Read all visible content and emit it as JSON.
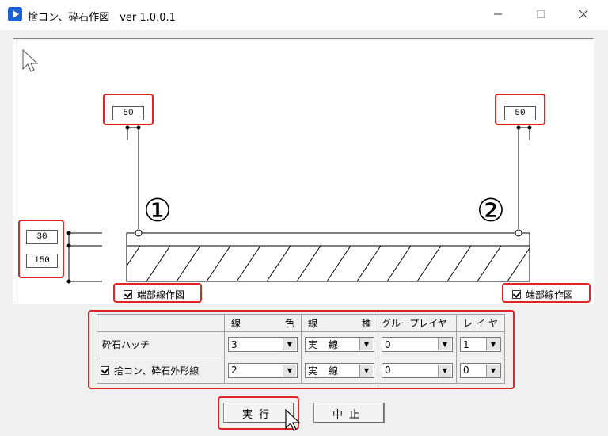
{
  "window": {
    "title": "捨コン、砕石作図　ver 1.0.0.1",
    "controls": [
      "minimize-icon",
      "maximize-icon",
      "close-icon"
    ]
  },
  "canvas": {
    "top_left_value": "50",
    "top_right_value": "50",
    "left_upper_value": "30",
    "left_lower_value": "150",
    "marker_1": "①",
    "marker_2": "②",
    "end_line_left": {
      "label": "端部線作図",
      "checked": true
    },
    "end_line_right": {
      "label": "端部線作図",
      "checked": true
    }
  },
  "settings": {
    "headers": {
      "color": [
        "線",
        "色"
      ],
      "linetype": [
        "線",
        "種"
      ],
      "group_layer": "グループレイヤ",
      "layer": [
        "レ",
        "イ",
        "ヤ"
      ]
    },
    "rows": [
      {
        "label": "砕石ハッチ",
        "has_checkbox": false,
        "color": "3",
        "linetype": [
          "実",
          "線"
        ],
        "group_layer": "0",
        "layer": "1"
      },
      {
        "label": "捨コン、砕石外形線",
        "has_checkbox": true,
        "checked": true,
        "color": "2",
        "linetype": [
          "実",
          "線"
        ],
        "group_layer": "0",
        "layer": "0"
      }
    ]
  },
  "buttons": {
    "execute": "実行",
    "cancel": "中止"
  },
  "colors": {
    "highlight": "#e02424",
    "app_icon": "#1a5fd6"
  }
}
